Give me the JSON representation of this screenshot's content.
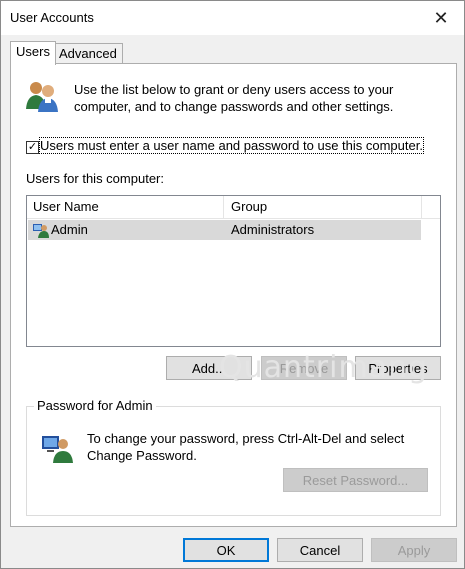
{
  "window": {
    "title": "User Accounts",
    "close_glyph": "✕"
  },
  "tabs": [
    {
      "label": "Users",
      "active": true
    },
    {
      "label": "Advanced",
      "active": false
    }
  ],
  "users_tab": {
    "description_line1": "Use the list below to grant or deny users access to your",
    "description_line2": "computer, and to change passwords and other settings.",
    "require_login_checkbox": {
      "checked": true,
      "check_glyph": "✓",
      "label": "Users must enter a user name and password to use this computer."
    },
    "users_label": "Users for this computer:",
    "list": {
      "columns": [
        "User Name",
        "Group"
      ],
      "rows": [
        {
          "user_name": "Admin",
          "group": "Administrators",
          "icon": "user-icon"
        }
      ]
    },
    "buttons": {
      "add": "Add...",
      "remove": "Remove",
      "properties": "Properties"
    },
    "password_group": {
      "legend": "Password for Admin",
      "text_line1": "To change your password, press Ctrl-Alt-Del and select",
      "text_line2": "Change Password.",
      "reset_button": "Reset Password..."
    }
  },
  "watermark": "Quantrimang",
  "dialog_buttons": {
    "ok": "OK",
    "cancel": "Cancel",
    "apply": "Apply"
  },
  "colors": {
    "accent": "#0078d7",
    "selection": "#d9d9d9",
    "disabled_text": "#9a9a9a"
  }
}
